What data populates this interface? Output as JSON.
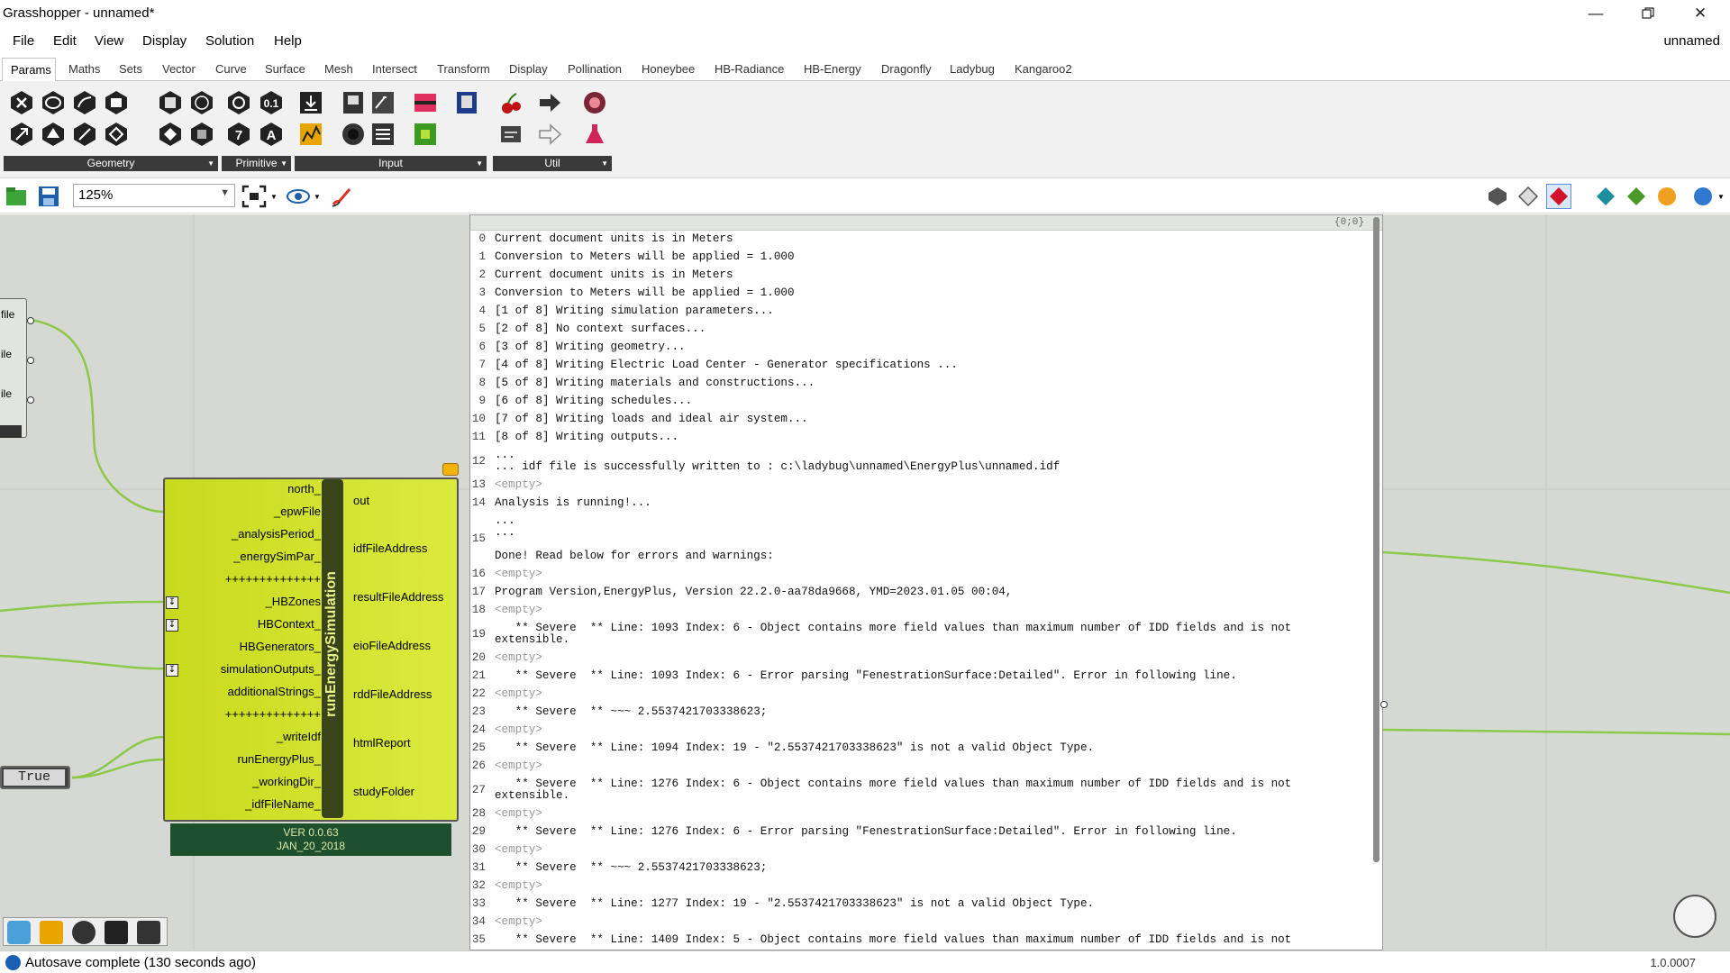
{
  "window": {
    "title": "Grasshopper - unnamed*",
    "doc_name": "unnamed"
  },
  "menu": [
    "File",
    "Edit",
    "View",
    "Display",
    "Solution",
    "Help"
  ],
  "tabs": [
    "Params",
    "Maths",
    "Sets",
    "Vector",
    "Curve",
    "Surface",
    "Mesh",
    "Intersect",
    "Transform",
    "Display",
    "Pollination",
    "Honeybee",
    "HB-Radiance",
    "HB-Energy",
    "Dragonfly",
    "Ladybug",
    "Kangaroo2"
  ],
  "ribbon_panels": [
    "Geometry",
    "Primitive",
    "Input",
    "Util"
  ],
  "toolbar": {
    "zoom": "125%"
  },
  "panel": {
    "path": "{0;0}",
    "lines": [
      "Current document units is in Meters",
      "Conversion to Meters will be applied = 1.000",
      "Current document units is in Meters",
      "Conversion to Meters will be applied = 1.000",
      "[1 of 8] Writing simulation parameters...",
      "[2 of 8] No context surfaces...",
      "[3 of 8] Writing geometry...",
      "[4 of 8] Writing Electric Load Center - Generator specifications ...",
      "[5 of 8] Writing materials and constructions...",
      "[6 of 8] Writing schedules...",
      "[7 of 8] Writing loads and ideal air system...",
      "[8 of 8] Writing outputs...",
      "...\n... idf file is successfully written to : c:\\ladybug\\unnamed\\EnergyPlus\\unnamed.idf",
      "<empty>",
      "Analysis is running!...",
      "...\n...\n\nDone! Read below for errors and warnings:",
      "<empty>",
      "Program Version,EnergyPlus, Version 22.2.0-aa78da9668, YMD=2023.01.05 00:04,",
      "<empty>",
      "   ** Severe  ** Line: 1093 Index: 6 - Object contains more field values than maximum number of IDD fields and is not\nextensible.",
      "<empty>",
      "   ** Severe  ** Line: 1093 Index: 6 - Error parsing \"FenestrationSurface:Detailed\". Error in following line.",
      "<empty>",
      "   ** Severe  ** ~~~ 2.5537421703338623;",
      "<empty>",
      "   ** Severe  ** Line: 1094 Index: 19 - \"2.5537421703338623\" is not a valid Object Type.",
      "<empty>",
      "   ** Severe  ** Line: 1276 Index: 6 - Object contains more field values than maximum number of IDD fields and is not\nextensible.",
      "<empty>",
      "   ** Severe  ** Line: 1276 Index: 6 - Error parsing \"FenestrationSurface:Detailed\". Error in following line.",
      "<empty>",
      "   ** Severe  ** ~~~ 2.5537421703338623;",
      "<empty>",
      "   ** Severe  ** Line: 1277 Index: 19 - \"2.5537421703338623\" is not a valid Object Type.",
      "<empty>",
      "   ** Severe  ** Line: 1409 Index: 5 - Object contains more field values than maximum number of IDD fields and is not"
    ]
  },
  "component": {
    "name": "runEnergySimulation",
    "inputs": [
      "north_",
      "_epwFile",
      "_analysisPeriod_",
      "_energySimPar_",
      "++++++++++++++",
      "_HBZones",
      "HBContext_",
      "HBGenerators_",
      "simulationOutputs_",
      "additionalStrings_",
      "++++++++++++++",
      "_writeIdf",
      "runEnergyPlus_",
      "_workingDir_",
      "_idfFileName_"
    ],
    "outputs": [
      "out",
      "idfFileAddress",
      "resultFileAddress",
      "eioFileAddress",
      "rddFileAddress",
      "htmlReport",
      "studyFolder"
    ],
    "version": "VER 0.0.63",
    "date": "JAN_20_2018"
  },
  "left_params": [
    "file",
    "ile",
    "ile"
  ],
  "toggle": {
    "value": "True"
  },
  "status": {
    "text": "Autosave complete (130 seconds ago)",
    "version": "1.0.0007"
  }
}
